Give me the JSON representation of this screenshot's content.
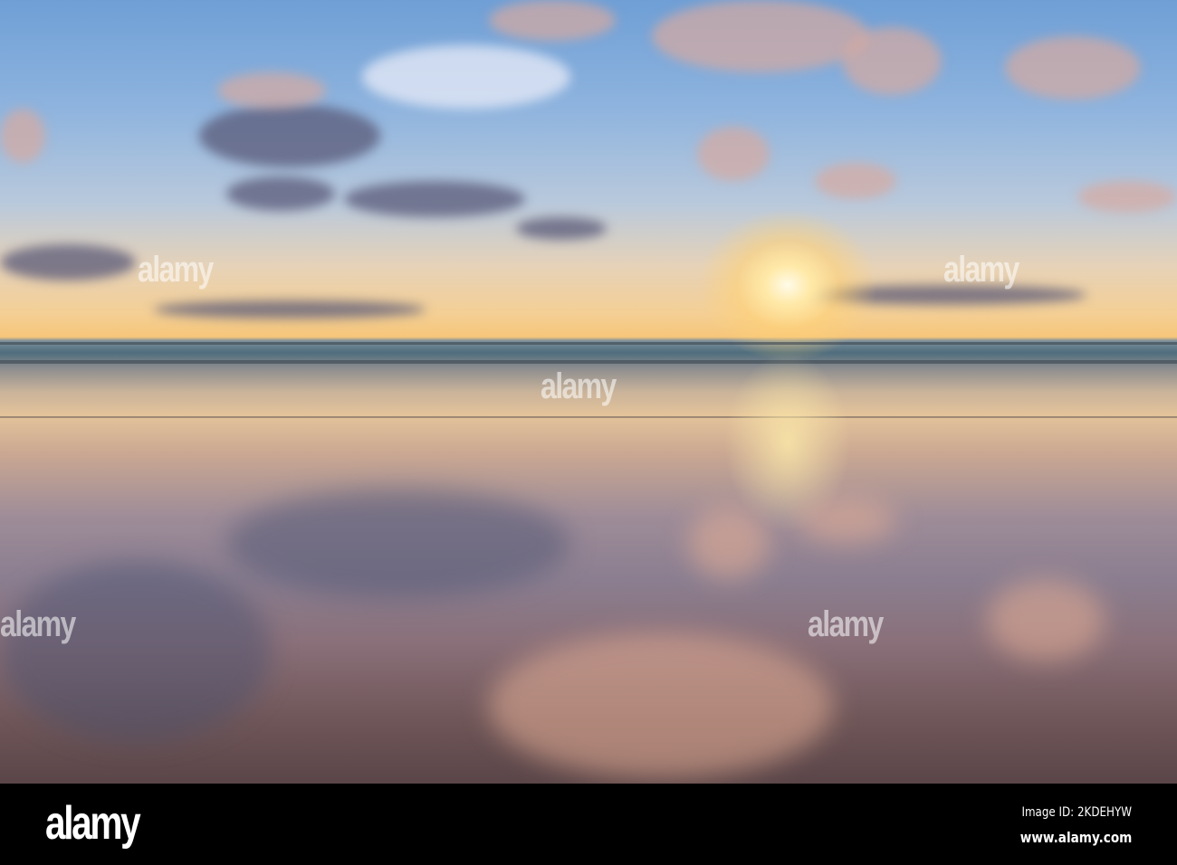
{
  "scene": {
    "description_colors": {
      "sky_top": "#6f9fd6",
      "sun": "#fffbe8",
      "sand": "#8a7079"
    },
    "watermark_text": "alamy"
  },
  "footer": {
    "logo": "alamy",
    "image_id": "Image ID: 2KDEHYW",
    "url": "www.alamy.com"
  }
}
